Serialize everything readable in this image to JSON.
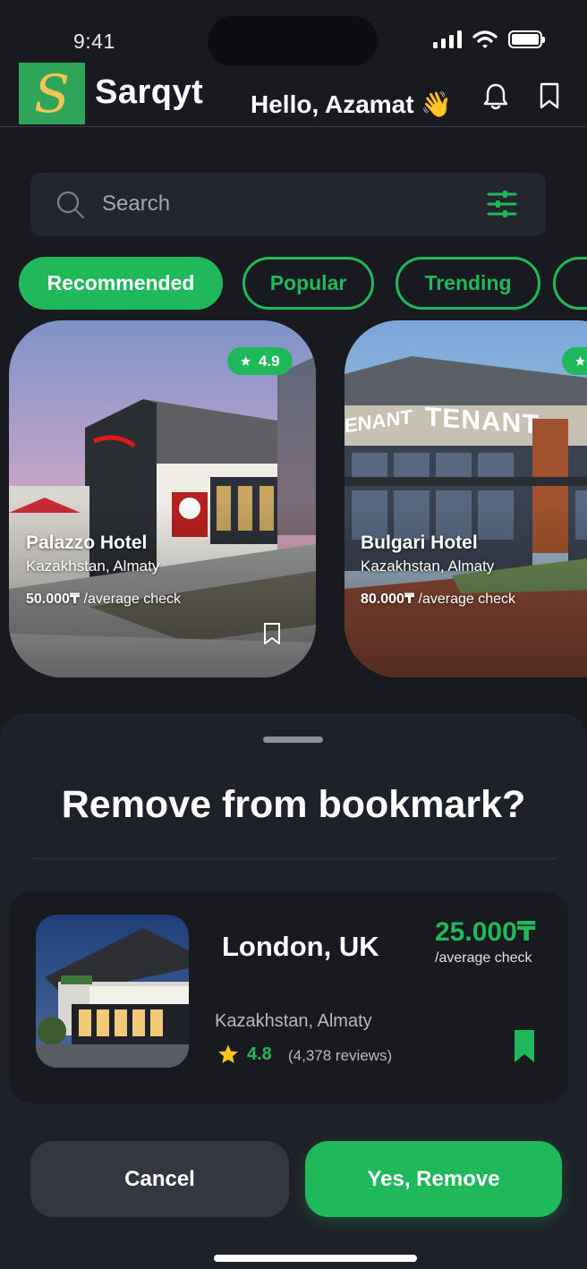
{
  "status_bar": {
    "time": "9:41"
  },
  "header": {
    "logo_letter": "S",
    "brand": "Sarqyt",
    "greeting": "Hello, Azamat 👋"
  },
  "search": {
    "placeholder": "Search"
  },
  "chips": [
    {
      "label": "Recommended",
      "active": true
    },
    {
      "label": "Popular",
      "active": false
    },
    {
      "label": "Trending",
      "active": false
    }
  ],
  "cards": [
    {
      "rating": "4.9",
      "name": "Palazzo Hotel",
      "location": "Kazakhstan, Almaty",
      "price": "50.000₸",
      "price_suffix": " /average check"
    },
    {
      "sign": "TENANT",
      "sign_left": "ENANT",
      "name": "Bulgari Hotel",
      "location": "Kazakhstan, Almaty",
      "price": "80.000₸",
      "price_suffix": " /average check"
    }
  ],
  "sheet": {
    "title": "Remove from bookmark?",
    "item": {
      "name": "London, UK",
      "price": "25.000₸",
      "price_suffix": "/average check",
      "location": "Kazakhstan, Almaty",
      "rating": "4.8",
      "reviews": "(4,378 reviews)"
    },
    "cancel_label": "Cancel",
    "confirm_label": "Yes, Remove"
  },
  "colors": {
    "accent": "#1fb85a",
    "background": "#181a20",
    "sheet": "#1f2128",
    "star": "#f5c518"
  }
}
